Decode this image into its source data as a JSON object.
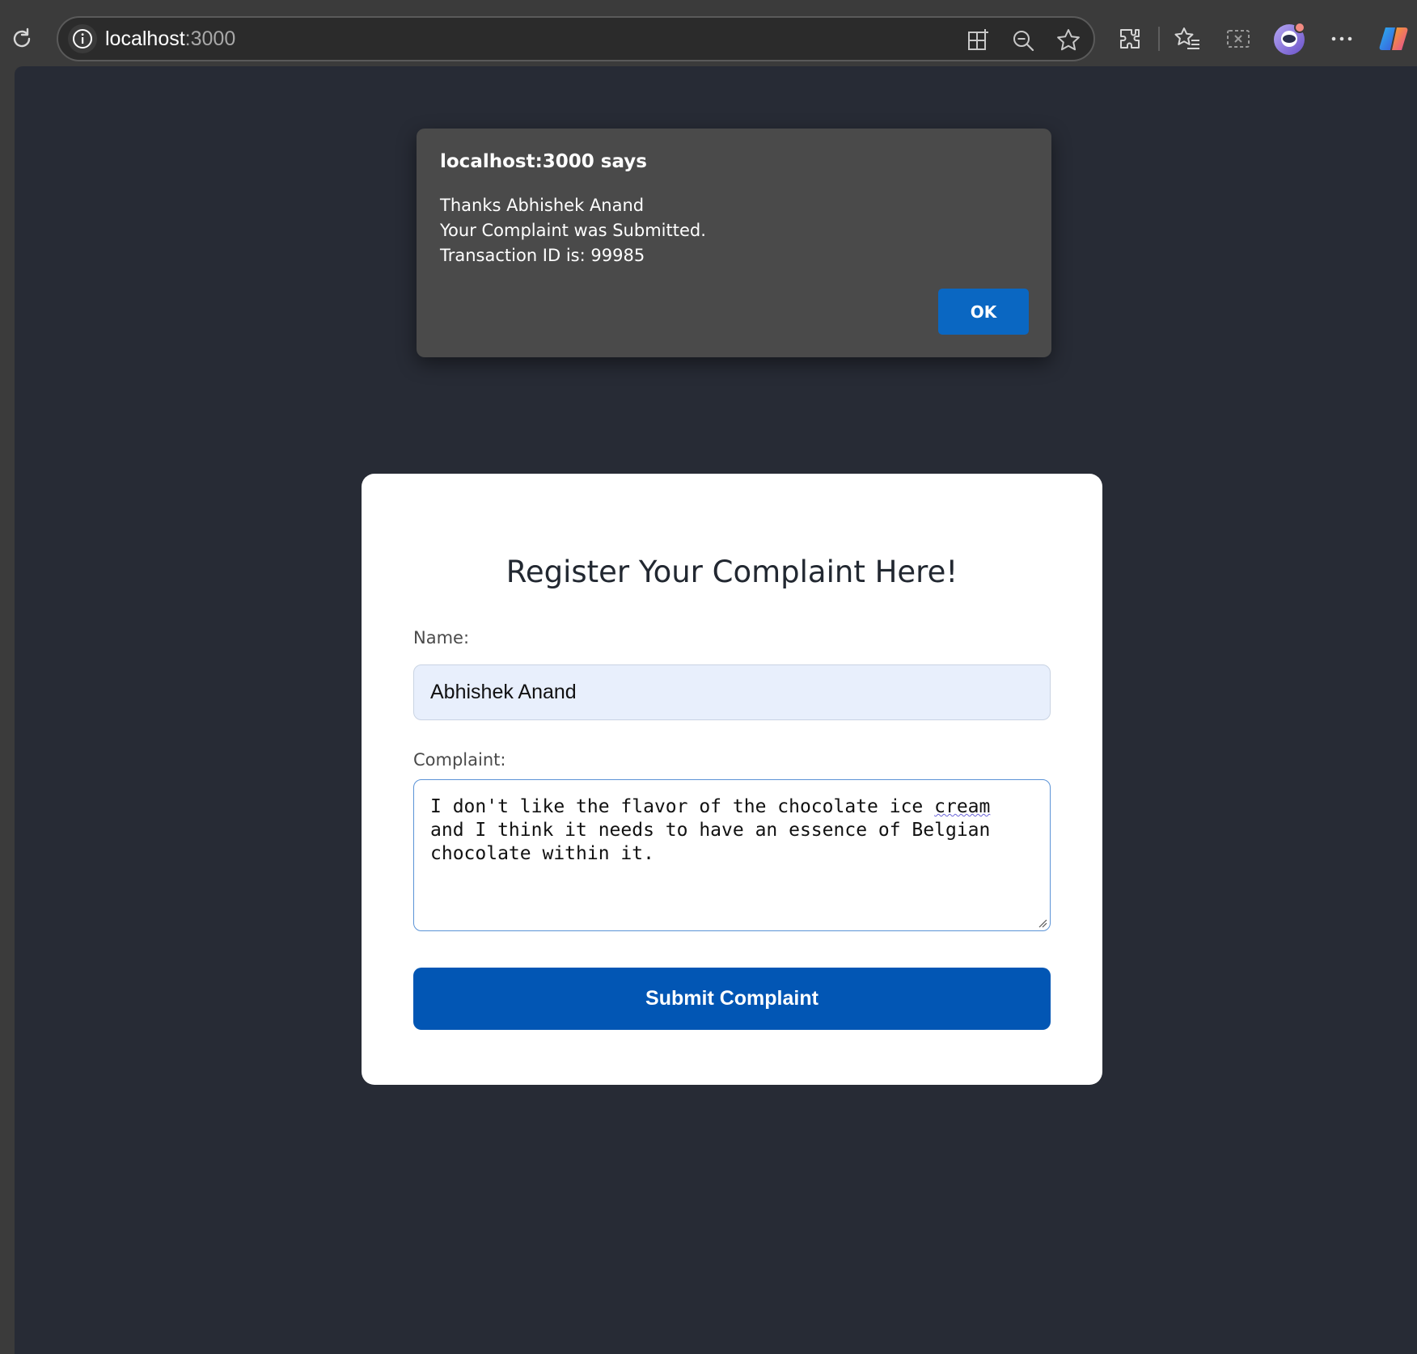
{
  "browser": {
    "url_host": "localhost",
    "url_port": ":3000",
    "icons": [
      "refresh-icon",
      "site-info-icon",
      "split-screen-icon",
      "zoom-out-icon",
      "favorite-star-icon",
      "extensions-icon",
      "favorites-icon",
      "screenshot-icon",
      "profile-avatar-icon",
      "more-menu-icon",
      "copilot-icon"
    ]
  },
  "dialog": {
    "title": "localhost:3000 says",
    "line1": "Thanks Abhishek Anand",
    "line2": "Your Complaint was Submitted.",
    "line3": "Transaction ID is: 99985",
    "ok_label": "OK"
  },
  "form": {
    "title": "Register Your Complaint Here!",
    "name_label": "Name:",
    "name_value": "Abhishek Anand",
    "complaint_label": "Complaint:",
    "complaint_part1": "I don't like the flavor of the chocolate ice ",
    "complaint_spell": "cream",
    "complaint_part2": "\nand I think it needs to have an essence of Belgian\nchocolate within it.",
    "submit_label": "Submit Complaint"
  },
  "colors": {
    "page_bg": "#272b35",
    "dialog_bg": "#4a4a4a",
    "ok_button": "#0a67c2",
    "submit_button": "#0256b4",
    "name_input_bg": "#e8effc"
  }
}
